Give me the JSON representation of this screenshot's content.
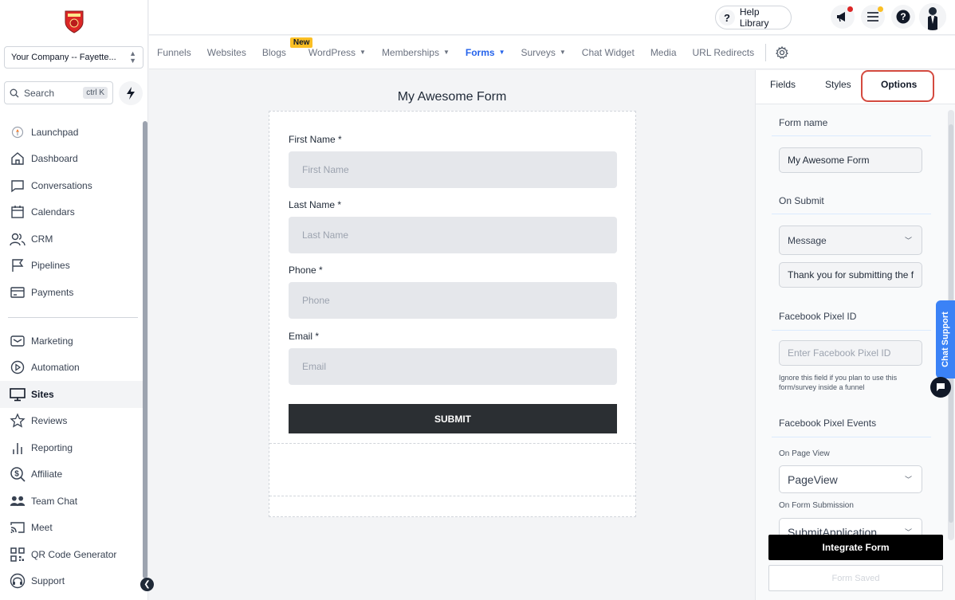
{
  "colors": {
    "active_link": "#2563eb",
    "badge": "#fbbf24",
    "highlight": "#d44a3f",
    "submit": "#2b2f33"
  },
  "sidebar": {
    "company": "Your Company -- Fayette...",
    "search_label": "Search",
    "search_shortcut": "ctrl K",
    "items_top": [
      {
        "label": "Launchpad",
        "icon": "launchpad-icon"
      },
      {
        "label": "Dashboard",
        "icon": "home-icon"
      },
      {
        "label": "Conversations",
        "icon": "chat-icon"
      },
      {
        "label": "Calendars",
        "icon": "calendar-icon"
      },
      {
        "label": "CRM",
        "icon": "users-icon"
      },
      {
        "label": "Pipelines",
        "icon": "flag-icon"
      },
      {
        "label": "Payments",
        "icon": "card-icon"
      }
    ],
    "items_bottom": [
      {
        "label": "Marketing",
        "icon": "mail-icon"
      },
      {
        "label": "Automation",
        "icon": "play-icon"
      },
      {
        "label": "Sites",
        "icon": "monitor-icon",
        "active": true
      },
      {
        "label": "Reviews",
        "icon": "star-icon"
      },
      {
        "label": "Reporting",
        "icon": "bar-chart-icon"
      },
      {
        "label": "Affiliate",
        "icon": "dollar-search-icon"
      },
      {
        "label": "Team Chat",
        "icon": "team-icon"
      },
      {
        "label": "Meet",
        "icon": "cast-icon"
      },
      {
        "label": "QR Code Generator",
        "icon": "qr-icon"
      },
      {
        "label": "Support",
        "icon": "headset-icon"
      }
    ]
  },
  "topbar": {
    "help_label": "Help Library",
    "help_glyph": "?"
  },
  "subnav": {
    "items": [
      "Funnels",
      "Websites",
      "Blogs",
      "WordPress",
      "Memberships",
      "Forms",
      "Surveys",
      "Chat Widget",
      "Media",
      "URL Redirects"
    ],
    "new_badge": "New"
  },
  "form": {
    "title": "My Awesome Form",
    "fields": [
      {
        "label": "First Name *",
        "placeholder": "First Name"
      },
      {
        "label": "Last Name *",
        "placeholder": "Last Name"
      },
      {
        "label": "Phone *",
        "placeholder": "Phone"
      },
      {
        "label": "Email *",
        "placeholder": "Email"
      }
    ],
    "submit_label": "SUBMIT"
  },
  "panel": {
    "tabs": [
      "Fields",
      "Styles",
      "Options"
    ],
    "form_name_title": "Form name",
    "form_name_value": "My Awesome Form",
    "on_submit_title": "On Submit",
    "on_submit_select": "Message",
    "message_value": "Thank you for submitting the f",
    "pixel_title": "Facebook Pixel ID",
    "pixel_placeholder": "Enter Facebook Pixel ID",
    "pixel_hint": "Ignore this field if you plan to use this form/survey inside a funnel",
    "events_title": "Facebook Pixel Events",
    "page_view_label": "On Page View",
    "page_view_value": "PageView",
    "submission_label": "On Form Submission",
    "submission_value": "SubmitApplication",
    "integrate_label": "Integrate Form",
    "saved_label": "Form Saved"
  },
  "chat_support_label": "Chat Support"
}
